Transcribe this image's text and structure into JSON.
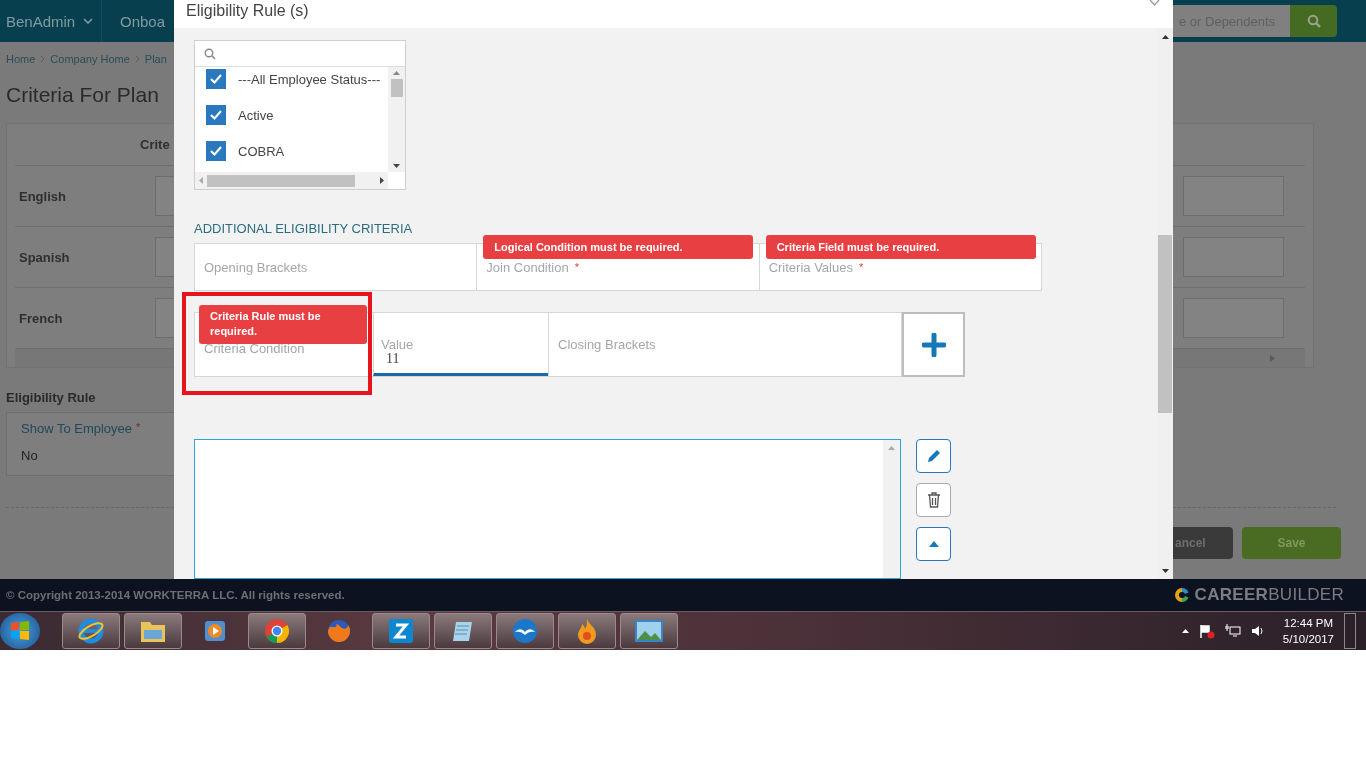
{
  "nav": {
    "items": [
      {
        "label": "BenAdmin",
        "kind": "dropdown"
      },
      {
        "label": "Onboa",
        "kind": "link"
      }
    ],
    "search": {
      "placeholder": "e or Dependents"
    }
  },
  "breadcrumb": [
    "Home",
    "Company Home",
    "Plan"
  ],
  "page_title": "Criteria For Plan",
  "criteria_table": {
    "columns": [
      "Crite"
    ],
    "rows": [
      {
        "language": "English"
      },
      {
        "language": "Spanish"
      },
      {
        "language": "French"
      }
    ]
  },
  "eligibility_rule": {
    "heading": "Eligibility Rule",
    "field": {
      "label": "Show To Employee",
      "required_mark": "*",
      "value": "No"
    }
  },
  "form_buttons": [
    {
      "label": "ancel",
      "kind": "secondary"
    },
    {
      "label": "Save",
      "kind": "primary"
    }
  ],
  "footer": {
    "copyright": "© Copyright 2013-2014 WORKTERRA LLC. All rights reserved.",
    "brand": "**CAREER**BUILDER"
  },
  "modal": {
    "title": "Eligibility Rule (s)",
    "status_list": {
      "items": [
        {
          "label": "---All Employee Status---",
          "checked": true
        },
        {
          "label": "Active",
          "checked": true
        },
        {
          "label": "COBRA",
          "checked": true
        }
      ]
    },
    "section_title": "ADDITIONAL ELIGIBILITY CRITERIA",
    "criteria_row_1": [
      {
        "label": "Opening Brackets"
      },
      {
        "label": "Join Condition",
        "required_mark": "*",
        "error": "Logical Condition must be required."
      },
      {
        "label": "Criteria Values",
        "required_mark": "*",
        "error": "Criteria Field must be required."
      }
    ],
    "criteria_row_2": [
      {
        "label": "Criteria Condition",
        "error": "Criteria Rule must be required.",
        "highlighted": true
      },
      {
        "label": "Value",
        "value": "11",
        "focused": true
      },
      {
        "label": "Closing Brackets"
      }
    ]
  },
  "taskbar": {
    "apps": [
      {
        "kind": "ie",
        "running": true
      },
      {
        "kind": "explorer",
        "running": true
      },
      {
        "kind": "media",
        "running": false
      },
      {
        "kind": "chrome",
        "running": true
      },
      {
        "kind": "firefox",
        "running": false
      },
      {
        "kind": "z",
        "running": true
      },
      {
        "kind": "notepad",
        "running": true
      },
      {
        "kind": "openoffice",
        "running": true
      },
      {
        "kind": "flame",
        "running": true
      },
      {
        "kind": "photo",
        "running": true
      }
    ],
    "clock": {
      "time": "12:44 PM",
      "date": "5/10/2017"
    }
  }
}
